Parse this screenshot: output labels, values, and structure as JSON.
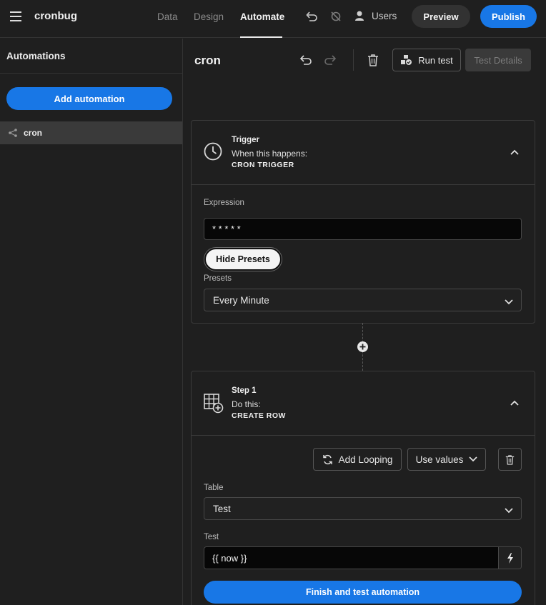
{
  "app": {
    "name": "cronbug"
  },
  "nav": {
    "tabs": [
      {
        "label": "Data",
        "active": false
      },
      {
        "label": "Design",
        "active": false
      },
      {
        "label": "Automate",
        "active": true
      }
    ],
    "users_label": "Users",
    "preview_label": "Preview",
    "publish_label": "Publish"
  },
  "sidebar": {
    "title": "Automations",
    "add_label": "Add automation",
    "items": [
      {
        "label": "cron",
        "icon": "share-icon",
        "selected": true
      }
    ]
  },
  "toolbar": {
    "title": "cron",
    "run_test_label": "Run test",
    "test_details_label": "Test Details"
  },
  "trigger": {
    "kicker": "Trigger",
    "subtitle": "When this happens:",
    "name": "CRON TRIGGER",
    "icon": "clock-icon",
    "expression_label": "Expression",
    "expression_value": "* * * * *",
    "hide_presets_label": "Hide Presets",
    "presets_label": "Presets",
    "presets_value": "Every Minute"
  },
  "step1": {
    "kicker": "Step 1",
    "subtitle": "Do this:",
    "name": "CREATE ROW",
    "icon": "table-add-icon",
    "add_looping_label": "Add Looping",
    "use_values_label": "Use values",
    "table_label": "Table",
    "table_value": "Test",
    "test_label": "Test",
    "test_value": "{{ now }}",
    "finish_label": "Finish and test automation"
  },
  "colors": {
    "accent": "#1877e6",
    "background": "#1f1f1f",
    "border": "#3a3a3a"
  }
}
